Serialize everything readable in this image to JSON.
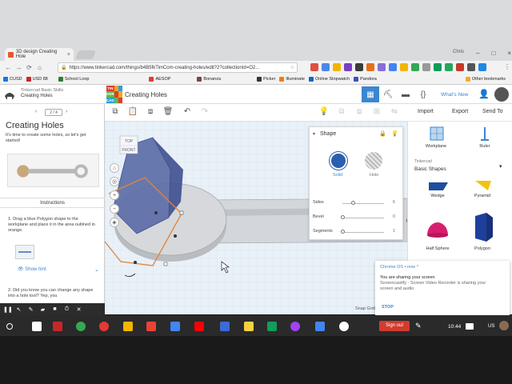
{
  "browser": {
    "tab_title": "3D design Creating Hole",
    "url": "https://www.tinkercad.com/things/b4B5fkTimCom-creating-holes/edit?2?collectionId=O2...",
    "bookmarks": [
      "CUSD",
      "USD 88",
      "School Loop",
      "AESOP",
      "Bonanza",
      "Picker",
      "Illuminate",
      "Online Stopwatch",
      "Pandora"
    ],
    "other_bookmarks": "Other bookmarks",
    "user_chip": "Chris"
  },
  "tinkercad": {
    "breadcrumb_course": "Tinkercad Basic Skills",
    "breadcrumb_lesson": "Creating Holes",
    "logo_letters": [
      "TIN",
      "KER",
      "CAD"
    ],
    "project_title": "Creating Holes",
    "whats_new": "What's New",
    "import_label": "Import",
    "export_label": "Export",
    "send_to_label": "Send To"
  },
  "lesson": {
    "pager": "2 / 4",
    "title": "Creating Holes",
    "intro": "It's time to create some holes, so let's get started!",
    "instructions_header": "Instructions",
    "step1": "1. Drag a blue Polygon shape to the workplane and place it in the area outlined in orange.",
    "show_hint": "Show hint",
    "step2": "2. Did you know you can change any shape into a hole tool? Yep, you"
  },
  "workplane": {
    "viewcube_top": "TOP",
    "viewcube_front": "FRONT",
    "snap_grid": "Snap Grid"
  },
  "inspector": {
    "title": "Shape",
    "solid_label": "Solid",
    "hole_label": "Hole",
    "solid_color": "#2a5eb0",
    "sides_label": "Sides",
    "sides_value": "6",
    "sides_level": 0.25,
    "bevel_label": "Bevel",
    "bevel_value": "0",
    "segments_label": "Segments",
    "segments_value": "1"
  },
  "shapes_panel": {
    "workplane_label": "Workplane",
    "ruler_label": "Ruler",
    "library_source": "Tinkercad",
    "library_selected": "Basic Shapes",
    "items": [
      "Wedge",
      "Pyramid",
      "Half Sphere",
      "Polygon"
    ]
  },
  "notification": {
    "source": "Chrome OS • now ^",
    "title": "You are sharing your screen",
    "body": "Screencastify - Screen Video Recorder is sharing your screen and audio.",
    "stop_label": "STOP"
  },
  "shelf": {
    "sign_out": "Sign out",
    "time": "10:44",
    "keyboard": "US"
  }
}
